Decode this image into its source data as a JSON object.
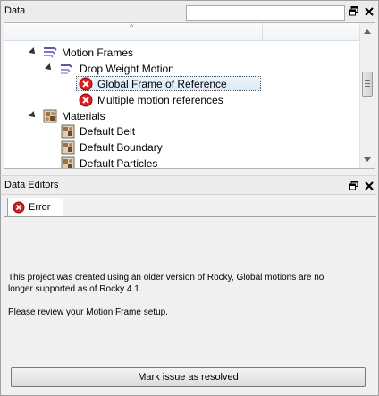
{
  "data_panel": {
    "title": "Data",
    "search": {
      "value": "",
      "placeholder": ""
    },
    "tree": [
      {
        "label": "Motion Frames",
        "icon": "motion-frames-icon",
        "expanded": true
      },
      {
        "label": "Drop Weight Motion",
        "icon": "motion-frame-icon",
        "expanded": true
      },
      {
        "label": "Global Frame of Reference",
        "icon": "error-icon",
        "selected": true
      },
      {
        "label": "Multiple motion references",
        "icon": "error-icon"
      },
      {
        "label": "Materials",
        "icon": "materials-icon",
        "expanded": true
      },
      {
        "label": "Default Belt",
        "icon": "material-icon"
      },
      {
        "label": "Default Boundary",
        "icon": "material-icon"
      },
      {
        "label": "Default Particles",
        "icon": "material-icon"
      }
    ]
  },
  "editors_panel": {
    "title": "Data Editors",
    "tab_label": "Error",
    "message_line1": "This project was created using an older version of Rocky, Global motions are no",
    "message_line2": "longer supported as of Rocky 4.1.",
    "message_line3": "Please review your Motion Frame setup.",
    "button_label": "Mark issue as resolved"
  },
  "colors": {
    "error_red": "#d81e1e",
    "selection_bg": "#dbe9f8",
    "panel_bg": "#f0f0f0"
  }
}
